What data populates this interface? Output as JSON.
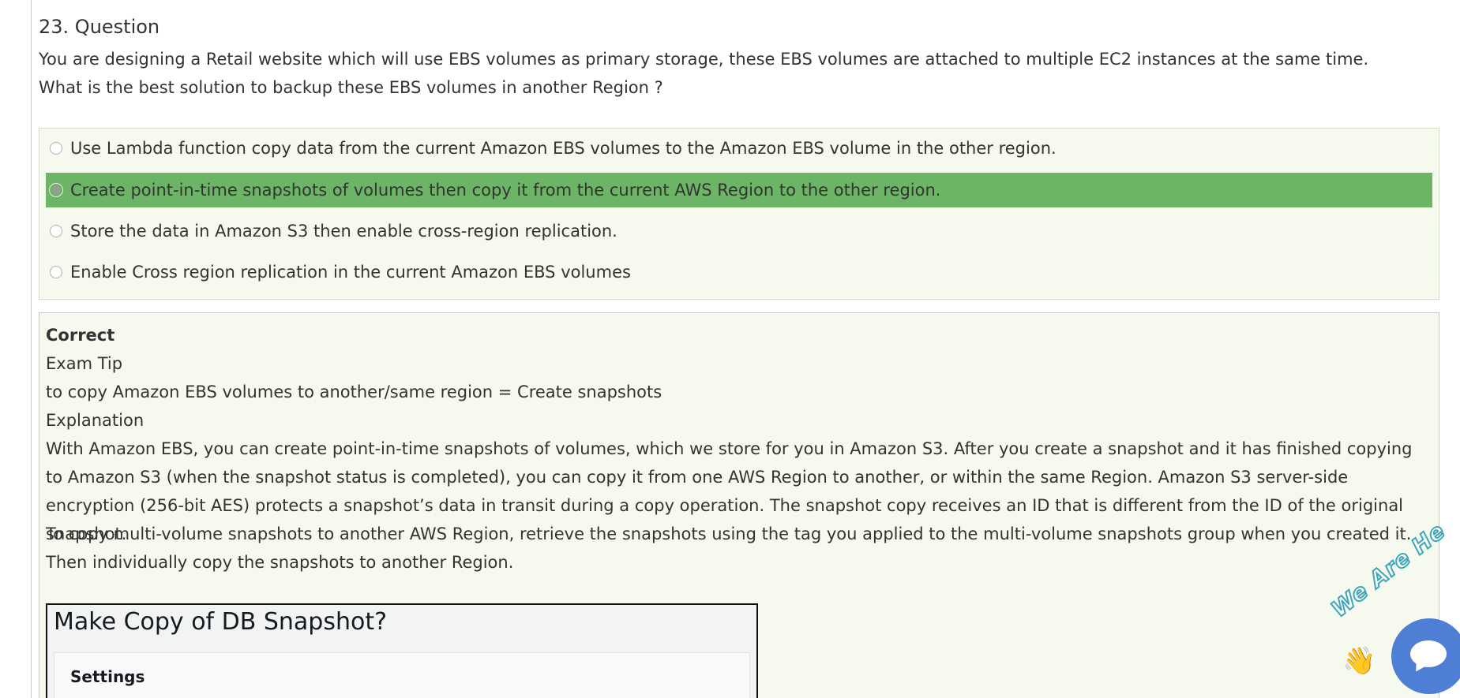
{
  "question": {
    "title": "23. Question",
    "line1": "You are designing a Retail website which will use EBS volumes as primary storage, these EBS volumes are attached to multiple EC2 instances at the same time.",
    "line2": "What is the best solution to backup these EBS volumes in another Region ?"
  },
  "options": [
    {
      "label": "Use Lambda function copy data from the current Amazon EBS volumes to the Amazon EBS volume in the other region.",
      "selected": false
    },
    {
      "label": "Create point-in-time snapshots of volumes then copy it from the current AWS Region to the other region.",
      "selected": true
    },
    {
      "label": "Store the data in Amazon S3 then enable cross-region replication.",
      "selected": false
    },
    {
      "label": "Enable Cross region replication in the current Amazon EBS volumes",
      "selected": false
    }
  ],
  "explanation": {
    "status": "Correct",
    "tip_heading": "Exam Tip",
    "tip": "to copy Amazon EBS volumes to another/same region = Create snapshots",
    "heading": "Explanation",
    "para1": "With Amazon EBS, you can create point-in-time snapshots of volumes, which we store for you in Amazon S3. After you create a snapshot and it has finished copying to Amazon S3 (when the snapshot status is completed), you can copy it from one AWS Region to another, or within the same Region. Amazon S3 server-side encryption (256-bit AES) protects a snapshot’s data in transit during a copy operation. The snapshot copy receives an ID that is different from the ID of the original snapshot.",
    "para2": "To copy multi-volume snapshots to another AWS Region, retrieve the snapshots using the tag you applied to the multi-volume snapshots group when you created it. Then individually copy the snapshots to another Region."
  },
  "snapshot_image": {
    "title": "Make Copy of DB Snapshot?",
    "section": "Settings"
  },
  "chat_widget": {
    "text": "We Are He",
    "icon": "chat-bubble-icon",
    "wave_icon": "waving-hand-icon"
  },
  "colors": {
    "selected_option": "#6db566",
    "panel_bg": "#f6f9ee",
    "chat_blue": "#4e7fd4"
  }
}
